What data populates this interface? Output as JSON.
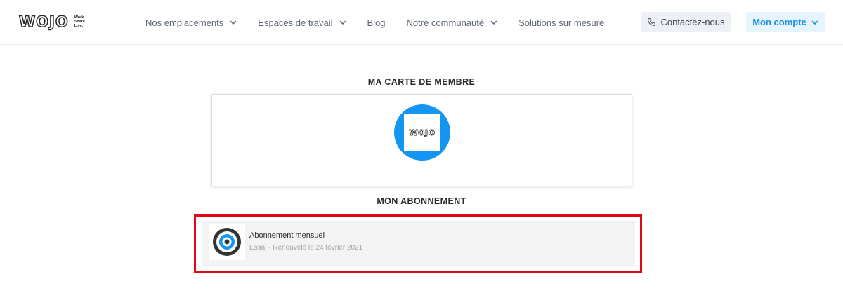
{
  "header": {
    "logo_text": "WOJO",
    "tagline": [
      "Work.",
      "Share.",
      "Live."
    ],
    "nav": [
      {
        "label": "Nos emplacements",
        "has_dropdown": true
      },
      {
        "label": "Espaces de travail",
        "has_dropdown": true
      },
      {
        "label": "Blog",
        "has_dropdown": false
      },
      {
        "label": "Notre communauté",
        "has_dropdown": true
      },
      {
        "label": "Solutions sur mesure",
        "has_dropdown": false
      }
    ],
    "contact_label": "Contactez-nous",
    "account_label": "Mon compte"
  },
  "member_card": {
    "title": "MA CARTE DE MEMBRE",
    "logo_text": "WOJO"
  },
  "subscription": {
    "title": "MON ABONNEMENT",
    "name": "Abonnement mensuel",
    "status": "Essai - Renouvelé le 24 février 2021"
  },
  "colors": {
    "brand_blue": "#1495f2",
    "highlight_red": "#e30613",
    "account_text": "#1a8fe3"
  },
  "icons": [
    "phone-icon",
    "chevron-down-icon",
    "target-icon"
  ]
}
